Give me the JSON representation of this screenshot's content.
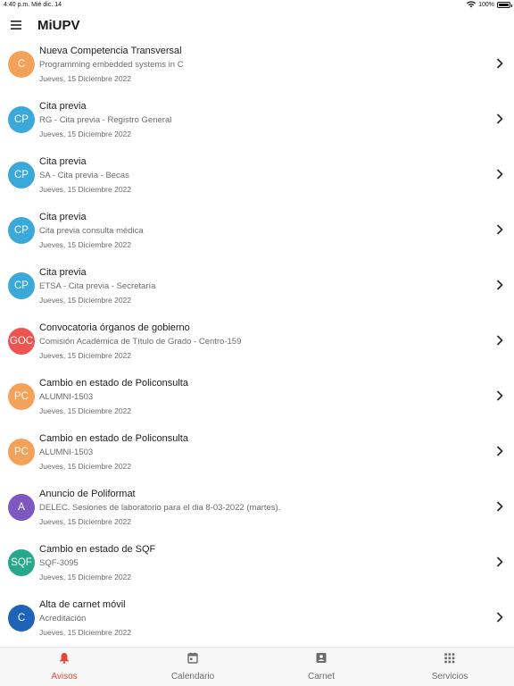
{
  "status_bar": {
    "time": "4:40 p.m.",
    "date": "Mié dic. 14",
    "battery": "100%"
  },
  "app": {
    "title": "MiUPV"
  },
  "items": [
    {
      "initials": "C",
      "color": "#f4a259",
      "title": "Nueva Competencia Transversal",
      "subtitle": "Programming embedded systems in C",
      "date": "Jueves, 15 Diciembre 2022"
    },
    {
      "initials": "CP",
      "color": "#3aa8d8",
      "title": "Cita previa",
      "subtitle": "RG - Cita previa - Registro General",
      "date": "Jueves, 15 Diciembre 2022"
    },
    {
      "initials": "CP",
      "color": "#3aa8d8",
      "title": "Cita previa",
      "subtitle": "SA  - Cita previa - Becas",
      "date": "Jueves, 15 Diciembre 2022"
    },
    {
      "initials": "CP",
      "color": "#3aa8d8",
      "title": "Cita previa",
      "subtitle": "Cita previa consulta médica",
      "date": "Jueves, 15 Diciembre 2022"
    },
    {
      "initials": "CP",
      "color": "#3aa8d8",
      "title": "Cita previa",
      "subtitle": "ETSA - Cita previa - Secretaría",
      "date": "Jueves, 15 Diciembre 2022"
    },
    {
      "initials": "GOC",
      "color": "#ef5350",
      "title": "Convocatoria órganos de gobierno",
      "subtitle": "Comisión Académica de Título de Grado - Centro-159",
      "date": "Jueves, 15 Diciembre 2022"
    },
    {
      "initials": "PC",
      "color": "#f4a259",
      "title": "Cambio en estado de Policonsulta",
      "subtitle": "ALUMNI-1503",
      "date": "Jueves, 15 Diciembre 2022"
    },
    {
      "initials": "PC",
      "color": "#f4a259",
      "title": "Cambio en estado de Policonsulta",
      "subtitle": "ALUMNI-1503",
      "date": "Jueves, 15 Diciembre 2022"
    },
    {
      "initials": "A",
      "color": "#7e57c2",
      "title": "Anuncio de Poliformat",
      "subtitle": "DELEC. Sesiones de laboratorio para el dia 8-03-2022 (martes).",
      "date": "Jueves, 15 Diciembre 2022"
    },
    {
      "initials": "SQF",
      "color": "#26a98b",
      "title": "Cambio en estado de SQF",
      "subtitle": "SQF-3095",
      "date": "Jueves, 15 Diciembre 2022"
    },
    {
      "initials": "C",
      "color": "#1e63b8",
      "title": "Alta de carnet móvil",
      "subtitle": "Acreditación",
      "date": "Jueves, 15 Diciembre 2022"
    }
  ],
  "tabs": [
    {
      "label": "Avisos",
      "icon": "bell-icon",
      "active": true
    },
    {
      "label": "Calendario",
      "icon": "calendar-icon",
      "active": false
    },
    {
      "label": "Carnet",
      "icon": "id-card-icon",
      "active": false
    },
    {
      "label": "Servicios",
      "icon": "grid-icon",
      "active": false
    }
  ],
  "colors": {
    "accent": "#e4463b",
    "inactive": "#6b6b6b"
  }
}
